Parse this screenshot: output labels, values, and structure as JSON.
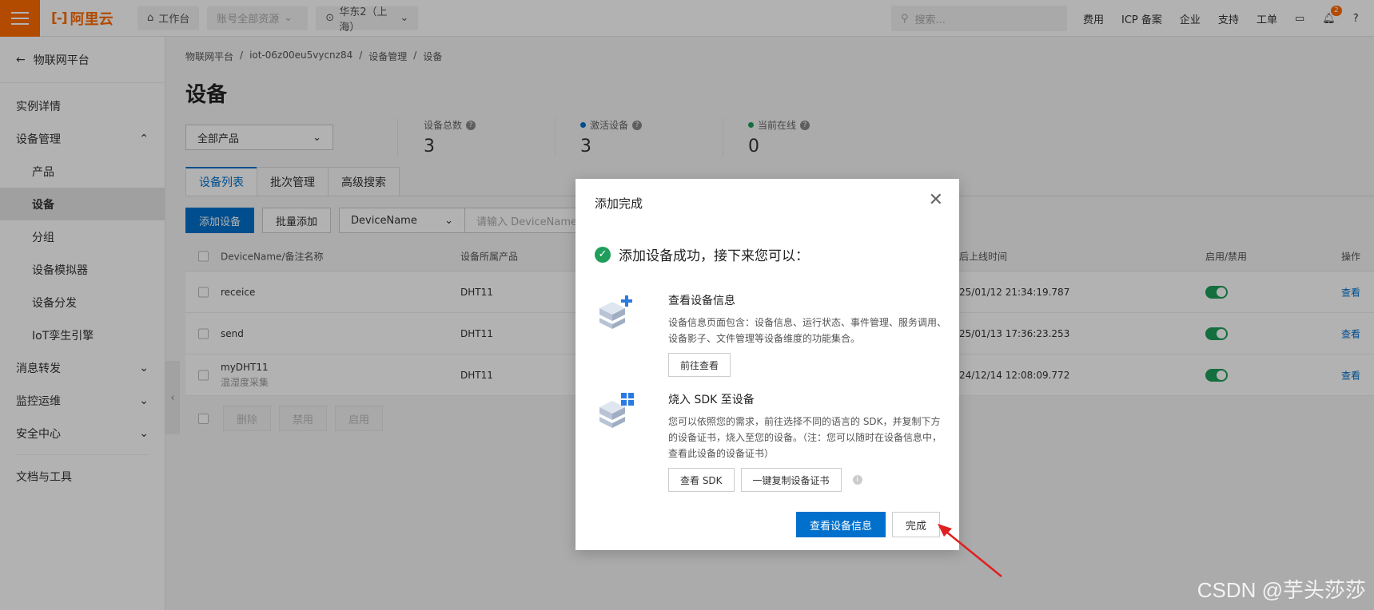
{
  "topbar": {
    "logo": "阿里云",
    "workbench": "工作台",
    "resources": "账号全部资源",
    "region": "华东2（上海）",
    "search_placeholder": "搜索...",
    "links": [
      "费用",
      "ICP 备案",
      "企业",
      "支持",
      "工单"
    ],
    "notification_count": "2"
  },
  "sidebar": {
    "back_label": "物联网平台",
    "items": [
      {
        "label": "实例详情"
      },
      {
        "label": "设备管理"
      },
      {
        "label": "产品"
      },
      {
        "label": "设备"
      },
      {
        "label": "分组"
      },
      {
        "label": "设备模拟器"
      },
      {
        "label": "设备分发"
      },
      {
        "label": "IoT孪生引擎"
      },
      {
        "label": "消息转发"
      },
      {
        "label": "监控运维"
      },
      {
        "label": "安全中心"
      },
      {
        "label": "文档与工具"
      }
    ]
  },
  "main": {
    "breadcrumb": [
      "物联网平台",
      "/",
      "iot-06z00eu5vycnz84",
      "/",
      "设备管理",
      "/",
      "设备"
    ],
    "title": "设备",
    "product_select": "全部产品",
    "stats": [
      {
        "label": "设备总数",
        "value": "3"
      },
      {
        "label": "激活设备",
        "value": "3",
        "color": "#0070cc"
      },
      {
        "label": "当前在线",
        "value": "0",
        "color": "#1e9e5a"
      }
    ],
    "tabs": [
      "设备列表",
      "批次管理",
      "高级搜索"
    ],
    "toolbar": {
      "add": "添加设备",
      "batch_add": "批量添加",
      "field": "DeviceName",
      "input_placeholder": "请输入 DeviceName"
    },
    "table": {
      "headers": [
        "DeviceName/备注名称",
        "设备所属产品",
        "后上线时间",
        "启用/禁用",
        "操作"
      ],
      "rows": [
        {
          "name": "receice",
          "note": "",
          "product": "DHT11",
          "time": "25/01/12 21:34:19.787",
          "action": "查看"
        },
        {
          "name": "send",
          "note": "",
          "product": "DHT11",
          "time": "25/01/13 17:36:23.253",
          "action": "查看"
        },
        {
          "name": "myDHT11",
          "note": "温湿度采集",
          "product": "DHT11",
          "time": "24/12/14 12:08:09.772",
          "action": "查看"
        }
      ]
    },
    "bulk": [
      "删除",
      "禁用",
      "启用"
    ]
  },
  "modal": {
    "title": "添加完成",
    "success": "添加设备成功，接下来您可以：",
    "step1": {
      "title": "查看设备信息",
      "desc": "设备信息页面包含：设备信息、运行状态、事件管理、服务调用、设备影子、文件管理等设备维度的功能集合。",
      "button": "前往查看"
    },
    "step2": {
      "title": "烧入 SDK 至设备",
      "desc": "您可以依照您的需求，前往选择不同的语言的 SDK，并复制下方的设备证书，烧入至您的设备。（注：您可以随时在设备信息中，查看此设备的设备证书）",
      "button1": "查看 SDK",
      "button2": "一键复制设备证书"
    },
    "footer": {
      "primary": "查看设备信息",
      "done": "完成"
    }
  },
  "watermark": "CSDN @芋头莎莎"
}
